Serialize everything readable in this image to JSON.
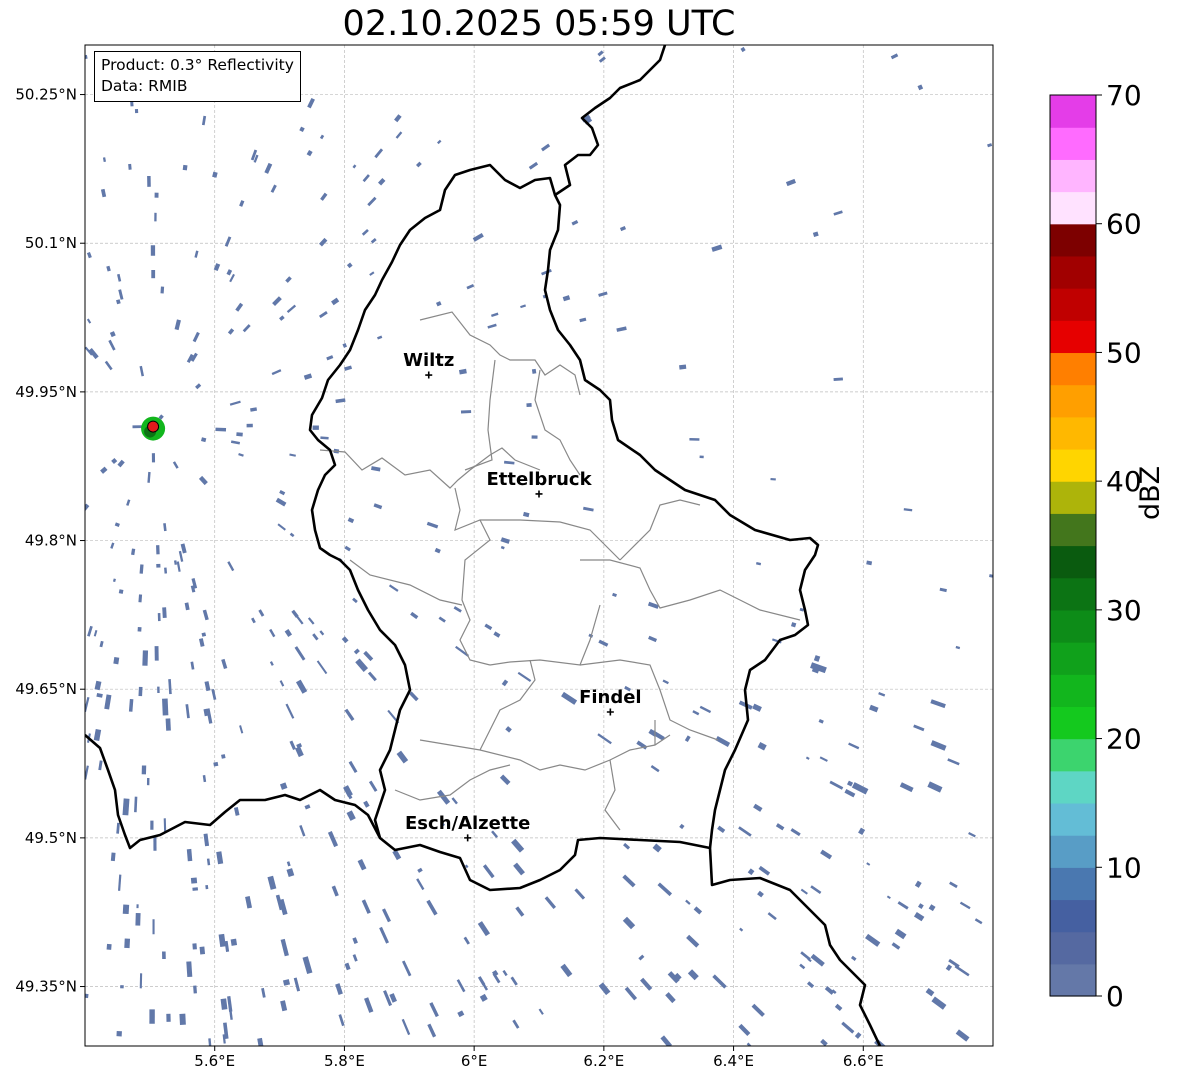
{
  "title": "02.10.2025 05:59 UTC",
  "info_box": {
    "product": "Product: 0.3° Reflectivity",
    "data": "Data: RMIB"
  },
  "map": {
    "lon_range": [
      5.4,
      6.8
    ],
    "lat_range": [
      49.29,
      50.3
    ],
    "lon_ticks": [
      {
        "value": 5.6,
        "label": "5.6°E"
      },
      {
        "value": 5.8,
        "label": "5.8°E"
      },
      {
        "value": 6.0,
        "label": "6°E"
      },
      {
        "value": 6.2,
        "label": "6.2°E"
      },
      {
        "value": 6.4,
        "label": "6.4°E"
      },
      {
        "value": 6.6,
        "label": "6.6°E"
      }
    ],
    "lat_ticks": [
      {
        "value": 50.25,
        "label": "50.25°N"
      },
      {
        "value": 50.1,
        "label": "50.1°N"
      },
      {
        "value": 49.95,
        "label": "49.95°N"
      },
      {
        "value": 49.8,
        "label": "49.8°N"
      },
      {
        "value": 49.65,
        "label": "49.65°N"
      },
      {
        "value": 49.5,
        "label": "49.5°N"
      },
      {
        "value": 49.35,
        "label": "49.35°N"
      }
    ],
    "cities": [
      {
        "name": "Wiltz",
        "lon": 5.93,
        "lat": 49.967
      },
      {
        "name": "Ettelbruck",
        "lon": 6.1,
        "lat": 49.847
      },
      {
        "name": "Findel",
        "lon": 6.21,
        "lat": 49.627
      },
      {
        "name": "Esch/Alzette",
        "lon": 5.99,
        "lat": 49.5
      }
    ],
    "radar_site": {
      "lon": 5.505,
      "lat": 49.915,
      "marker_color": "#e31a1c"
    },
    "echo_color": "#6178a9"
  },
  "colorbar": {
    "label": "dBZ",
    "min": 0,
    "max": 70,
    "ticks": [
      "0",
      "10",
      "20",
      "30",
      "40",
      "50",
      "60",
      "70"
    ],
    "colors": [
      "#6478a8",
      "#5569a1",
      "#4560a1",
      "#4a78b0",
      "#589dc6",
      "#63bdd6",
      "#5ed6c4",
      "#3cd46e",
      "#14c91e",
      "#12b61d",
      "#10a11b",
      "#0d8c18",
      "#0c7414",
      "#0a5b0f",
      "#43761c",
      "#adb40a",
      "#ffd500",
      "#ffb800",
      "#ff9f00",
      "#ff7f00",
      "#e60000",
      "#c00000",
      "#a10000",
      "#7d0000",
      "#ffe2ff",
      "#ffb5ff",
      "#ff6bff",
      "#e43de8"
    ]
  }
}
